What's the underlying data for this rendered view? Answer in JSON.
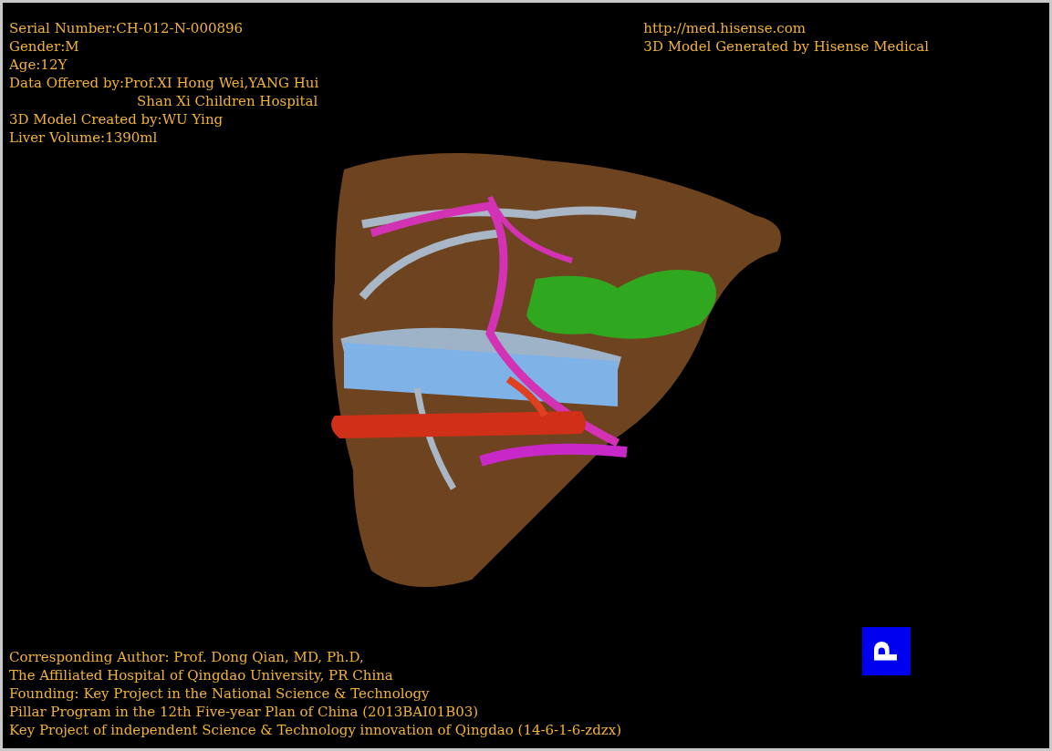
{
  "info_top_left": [
    {
      "text": "Serial Number:CH-012-N-000896",
      "kind": "plain"
    },
    {
      "text": "Gender:M",
      "kind": "plain"
    },
    {
      "text": "Age:12Y",
      "kind": "plain"
    },
    {
      "text": "Data Offered by:Prof.XI Hong Wei,YANG Hui",
      "kind": "plain"
    },
    {
      "text": "Shan Xi Children Hospital",
      "kind": "indented"
    },
    {
      "text": "3D Model Created by:WU Ying",
      "kind": "plain"
    },
    {
      "text": "Liver Volume:1390ml",
      "kind": "plain"
    }
  ],
  "info_top_right": [
    "http://med.hisense.com",
    "3D Model Generated by Hisense Medical"
  ],
  "orientation_marker": {
    "label": "P"
  },
  "info_bottom_left": [
    "Corresponding Author: Prof. Dong Qian, MD, Ph.D,",
    "The Affiliated Hospital of Qingdao University, PR China",
    "Founding: Key Project in the National Science & Technology",
    "Pillar Program in the 12th Five-year Plan of China (2013BAI01B03)",
    "Key Project of independent Science & Technology innovation of Qingdao (14-6-1-6-zdzx)"
  ]
}
